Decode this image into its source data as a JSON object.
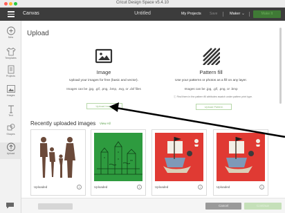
{
  "window": {
    "title": "Cricut Design Space  v5.4.10"
  },
  "header": {
    "app_name": "Canvas",
    "doc_title": "Untitled",
    "my_projects": "My Projects",
    "save": "Save",
    "machine": "Maker",
    "make_it": "Make It"
  },
  "sidebar": {
    "items": [
      {
        "label": "New",
        "icon": "plus-circle-icon"
      },
      {
        "label": "Templates",
        "icon": "shirt-icon"
      },
      {
        "label": "Projects",
        "icon": "projects-icon"
      },
      {
        "label": "Images",
        "icon": "images-icon"
      },
      {
        "label": "Text",
        "icon": "text-icon"
      },
      {
        "label": "Shapes",
        "icon": "shapes-icon"
      },
      {
        "label": "Upload",
        "icon": "upload-icon"
      }
    ],
    "active": "Upload"
  },
  "main": {
    "title": "Upload",
    "image_option": {
      "title": "Image",
      "desc": "Upload your images for free (basic and vector).",
      "types": "Images can be .jpg, .gif, .png, .bmp, .svg, or .dxf files",
      "button": "Upload Image"
    },
    "pattern_option": {
      "title": "Pattern fill",
      "desc": "Use your patterns or photos as a fill on any layer.",
      "types": "Images can be .jpg, .gif, .png, or .bmp",
      "note": "Find them in the pattern fill attributes swatch under pattern print type.",
      "button": "Upload Pattern"
    },
    "recent": {
      "title": "Recently uploaded images",
      "view_all": "View All",
      "cards": [
        {
          "label": "Uploaded",
          "kind": "family-silhouette"
        },
        {
          "label": "Uploaded",
          "kind": "green-castle"
        },
        {
          "label": "Uploaded",
          "kind": "pirate-ship"
        },
        {
          "label": "Uploaded",
          "kind": "pirate-ship"
        }
      ]
    }
  },
  "footer": {
    "cancel": "Cancel",
    "continue": "Continue"
  },
  "colors": {
    "appbar": "#3c3c3c",
    "accent_green": "#3f7a35",
    "card_red": "#e03a33",
    "card_green": "#2e9b3f"
  }
}
